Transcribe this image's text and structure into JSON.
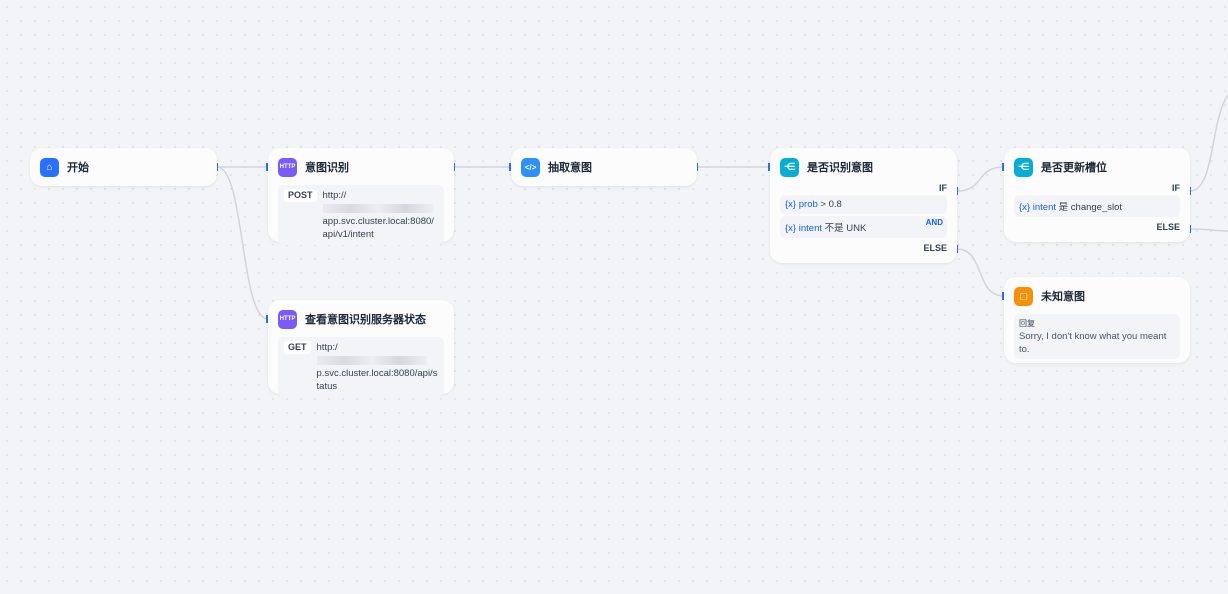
{
  "nodes": {
    "start": {
      "title": "开始"
    },
    "intent_http": {
      "title": "意图识别",
      "icon": "HTTP",
      "method": "POST",
      "url_prefix": "http://",
      "url_rest": "app.svc.cluster.local:8080/api/v1/intent"
    },
    "extract": {
      "title": "抽取意图"
    },
    "is_intent": {
      "title": "是否识别意图",
      "if": "IF",
      "else": "ELSE",
      "and": "AND",
      "conds": [
        {
          "var": "prob",
          "op": ">",
          "val": "0.8"
        },
        {
          "var": "intent",
          "op": "不是",
          "val": "UNK"
        }
      ]
    },
    "update_slot": {
      "title": "是否更新槽位",
      "if": "IF",
      "else": "ELSE",
      "conds": [
        {
          "var": "intent",
          "op": "是",
          "val": "change_slot"
        }
      ]
    },
    "unknown": {
      "title": "未知意图",
      "label": "回复",
      "text": "Sorry, I don't know what you meant to."
    },
    "status_http": {
      "title": "查看意图识别服务器状态",
      "icon": "HTTP",
      "method": "GET",
      "url_prefix": "http:/",
      "url_rest": "p.svc.cluster.local:8080/api/status"
    }
  },
  "var_icon": "{x}",
  "colors": {
    "accent": "#155eef",
    "http": "#7a5af8",
    "code": "#2e90fa",
    "ifelse": "#06aed4",
    "answer": "#f79009"
  }
}
